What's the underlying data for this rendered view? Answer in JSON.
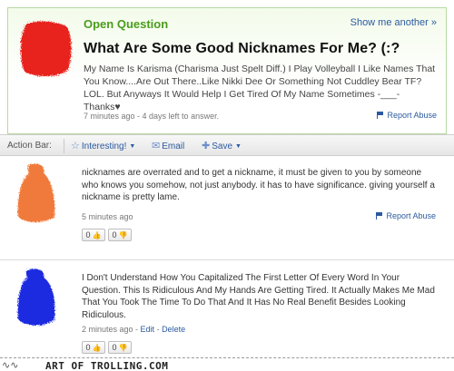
{
  "question": {
    "label": "Open Question",
    "show_more": "Show me another »",
    "title": "What Are Some Good Nicknames For Me? (:?",
    "body": "My Name Is Karisma (Charisma Just Spelt Diff.) I Play Volleyball I Like Names That You Know....Are Out There..Like Nikki Dee Or Something Not Cuddley Bear TF? LOL. But Anyways It Would Help I Get Tired Of My Name Sometimes -___- Thanks♥",
    "meta": "7 minutes ago - 4 days left to answer.",
    "report": "Report Abuse",
    "avatar_color": "#e8231c"
  },
  "action_bar": {
    "label": "Action Bar:",
    "interesting": "Interesting!",
    "email": "Email",
    "save": "Save"
  },
  "answers": [
    {
      "text": "nicknames are overrated and to get a nickname, it must be given to you by someone who knows you somehow, not just anybody. it has to have significance. giving yourself a nickname is pretty lame.",
      "meta": "5 minutes ago",
      "report": "Report Abuse",
      "thumbs_up": "0",
      "thumbs_down": "0",
      "avatar_color": "#f07a3a"
    },
    {
      "text": "I Don't Understand How You Capitalized The First Letter Of Every Word In Your Question. This Is Ridiculous And My Hands Are Getting Tired. It Actually Makes Me Mad That You Took The Time To Do That And It Has No Real Benefit Besides Looking Ridiculous.",
      "meta": "2 minutes ago - ",
      "edit": "Edit",
      "separator": " - ",
      "delete": "Delete",
      "thumbs_up": "0",
      "thumbs_down": "0",
      "avatar_color": "#1a2ae0"
    }
  ],
  "footer": {
    "brand": "ART OF TROLLING.COM",
    "deco": "∿∿"
  }
}
